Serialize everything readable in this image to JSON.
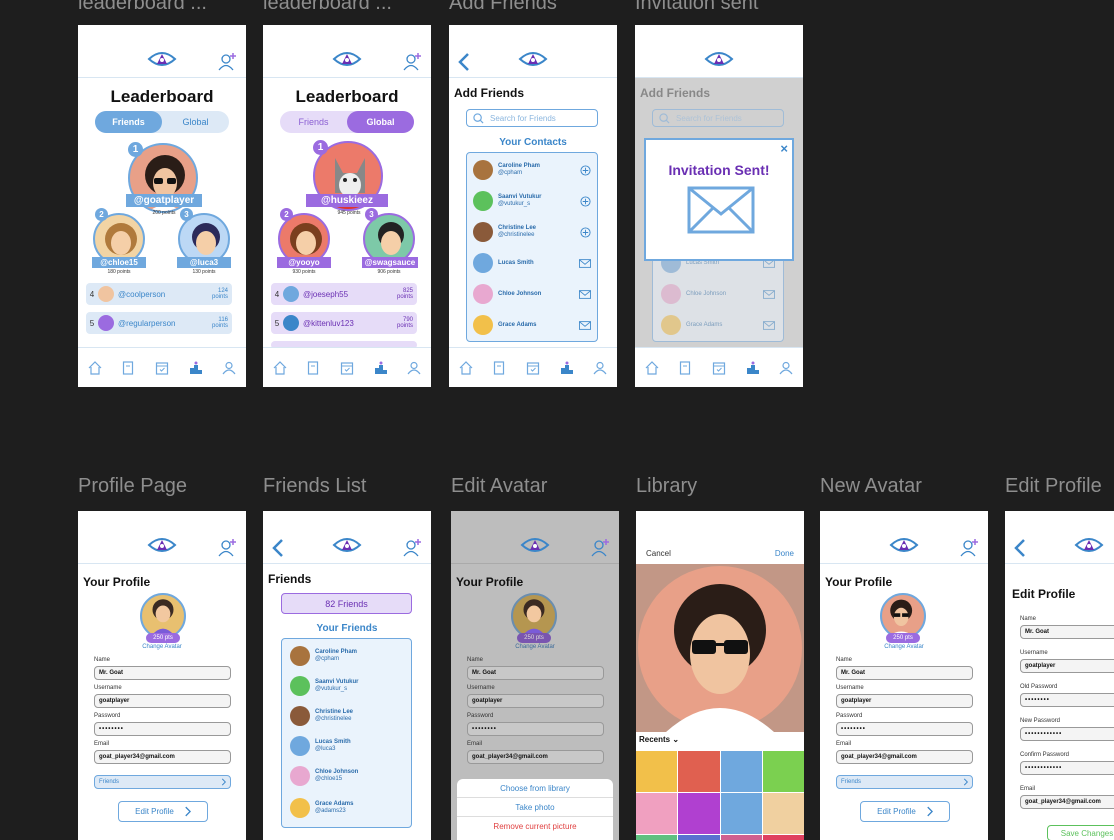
{
  "frame_titles": [
    "leaderboard ...",
    "leaderboard ...",
    "Add Friends",
    "Invitation sent",
    "Profile Page",
    "Friends List",
    "Edit Avatar",
    "Library",
    "New Avatar",
    "Edit Profile"
  ],
  "icons": [
    "eye-logo-icon",
    "add-user-icon",
    "back-chevron-icon",
    "home-icon",
    "book-icon",
    "calendar-icon",
    "leaderboard-icon",
    "profile-icon",
    "search-icon",
    "plus-circle-icon",
    "mail-icon",
    "close-icon",
    "envelope-icon",
    "chevron-right-icon",
    "chevron-down-icon"
  ],
  "colors": {
    "background": "#1e1e1e",
    "blue": "#6fa8de",
    "blue_dark": "#3b86c9",
    "purple": "#9b6be0",
    "purple_text": "#6a2fb3",
    "red_text": "#e04040",
    "green": "#5cc15c"
  },
  "lb_friends": {
    "title": "Leaderboard",
    "tab_friends": "Friends",
    "tab_global": "Global",
    "first": {
      "rank": "1",
      "handle": "@goatplayer",
      "points": "200 points"
    },
    "second": {
      "rank": "2",
      "handle": "@chloe15",
      "points": "180 points"
    },
    "third": {
      "rank": "3",
      "handle": "@luca3",
      "points": "130 points"
    },
    "rows": [
      {
        "rank": "4",
        "handle": "@coolperson",
        "points_value": "124",
        "points_unit": "points"
      },
      {
        "rank": "5",
        "handle": "@regularperson",
        "points_value": "116",
        "points_unit": "points"
      }
    ]
  },
  "lb_global": {
    "title": "Leaderboard",
    "tab_friends": "Friends",
    "tab_global": "Global",
    "first": {
      "rank": "1",
      "handle": "@huskieez",
      "points": "945 points"
    },
    "second": {
      "rank": "2",
      "handle": "@yooyo",
      "points": "930 points"
    },
    "third": {
      "rank": "3",
      "handle": "@swagsauce",
      "points": "906 points"
    },
    "rows": [
      {
        "rank": "4",
        "handle": "@joeseph55",
        "points_value": "825",
        "points_unit": "points"
      },
      {
        "rank": "5",
        "handle": "@kittenluv123",
        "points_value": "790",
        "points_unit": "points"
      }
    ]
  },
  "add_friends": {
    "title": "Add Friends",
    "search_placeholder": "Search for Friends",
    "contacts_title": "Your Contacts",
    "contacts": [
      {
        "name": "Caroline Pham",
        "handle": "@cpham",
        "action": "add"
      },
      {
        "name": "Saanvi Vutukur",
        "handle": "@vutukur_s",
        "action": "add"
      },
      {
        "name": "Christine Lee",
        "handle": "@christinelee",
        "action": "add"
      },
      {
        "name": "Lucas Smith",
        "handle": "",
        "action": "invite"
      },
      {
        "name": "Chloe Johnson",
        "handle": "",
        "action": "invite"
      },
      {
        "name": "Grace Adams",
        "handle": "",
        "action": "invite"
      }
    ]
  },
  "invitation": {
    "title": "Add Friends",
    "search_placeholder": "Search for Friends",
    "popup_text": "Invitation Sent!",
    "bg_names": [
      "Lucas Smith",
      "Chloe Johnson",
      "Grace Adams"
    ]
  },
  "profile": {
    "title": "Your Profile",
    "points_badge": "250 pts",
    "change_avatar": "Change Avatar",
    "name_label": "Name",
    "name": "Mr. Goat",
    "username_label": "Username",
    "username": "goatplayer",
    "password_label": "Password",
    "password": "••••••••",
    "email_label": "Email",
    "email": "goat_player34@gmail.com",
    "friends_button": "Friends",
    "edit_button": "Edit Profile"
  },
  "friends_list": {
    "title": "Friends",
    "count_button": "82 Friends",
    "list_title": "Your Friends",
    "friends": [
      {
        "name": "Caroline Pham",
        "handle": "@cpham"
      },
      {
        "name": "Saanvi Vutukur",
        "handle": "@vutukur_s"
      },
      {
        "name": "Christine Lee",
        "handle": "@christinelee"
      },
      {
        "name": "Lucas Smith",
        "handle": "@luca3"
      },
      {
        "name": "Chloe Johnson",
        "handle": "@chloe15"
      },
      {
        "name": "Grace Adams",
        "handle": "@adams23"
      }
    ]
  },
  "edit_avatar": {
    "sheet_choose": "Choose from library",
    "sheet_take": "Take photo",
    "sheet_remove": "Remove current picture"
  },
  "library": {
    "cancel": "Cancel",
    "done": "Done",
    "recents": "Recents"
  },
  "edit_profile": {
    "title": "Edit Profile",
    "name_label": "Name",
    "name": "Mr. Goat",
    "username_label": "Username",
    "username": "goatplayer",
    "old_password_label": "Old Password",
    "old_password": "••••••••",
    "new_password_label": "New Password",
    "new_password": "••••••••••••",
    "confirm_password_label": "Confirm Password",
    "confirm_password": "••••••••••••",
    "email_label": "Email",
    "email": "goat_player34@gmail.com",
    "save_button": "Save Changes"
  }
}
